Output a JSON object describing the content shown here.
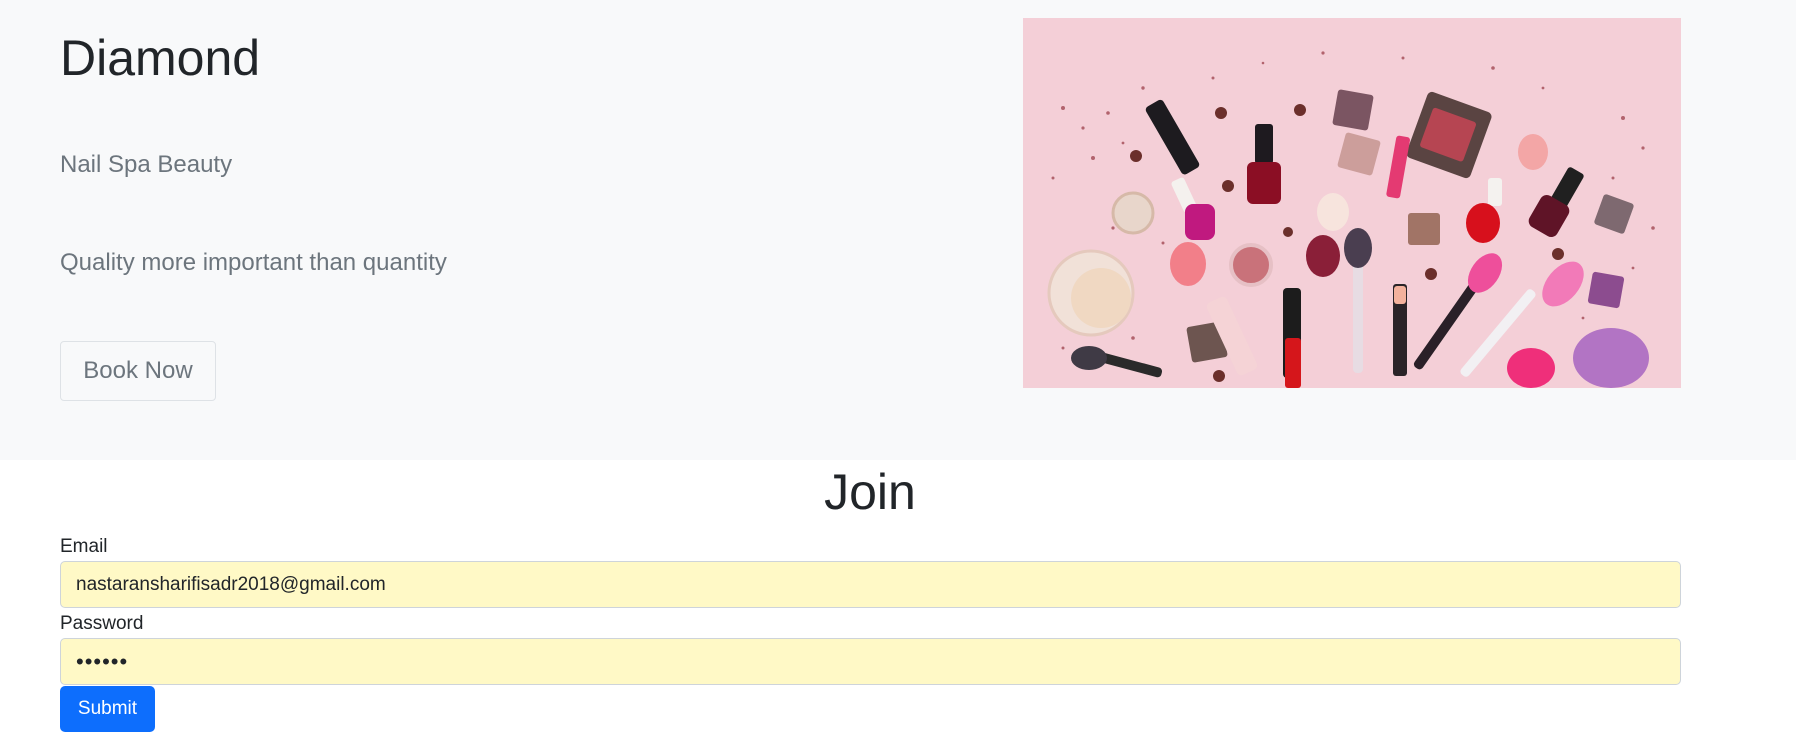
{
  "hero": {
    "title": "Diamond",
    "subtitle": "Nail Spa Beauty",
    "tagline": "Quality more important than quantity",
    "book_button_label": "Book Now",
    "image": {
      "icon": "cosmetics-flatlay-image",
      "background_color": "#f4cfd7"
    }
  },
  "join": {
    "heading": "Join",
    "email_label": "Email",
    "email_value": "nastaransharifisadr2018@gmail.com",
    "password_label": "Password",
    "password_value": "••••••",
    "submit_label": "Submit"
  },
  "colors": {
    "hero_background": "#f8f9fa",
    "muted_text": "#6c757d",
    "autofill_background": "#fff9c6",
    "primary": "#0d6efd"
  }
}
